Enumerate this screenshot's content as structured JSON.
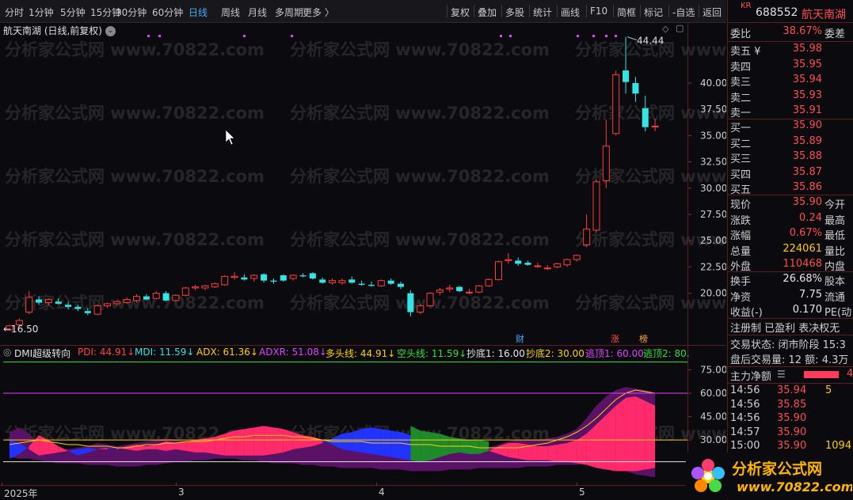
{
  "toolbar": {
    "periods": [
      "分时",
      "1分钟",
      "5分钟",
      "15分钟",
      "30分钟",
      "60分钟",
      "日线",
      "周线",
      "月线",
      "多周期",
      "更多 〉"
    ],
    "active_period": "日线",
    "tools": [
      "复权",
      "叠加",
      "多股",
      "统计",
      "画线",
      "F10",
      "简框",
      "标记",
      "-自选",
      "返回"
    ]
  },
  "stock": {
    "badge": "KR",
    "code": "688552",
    "name": "航天南湖"
  },
  "chart": {
    "title": "航天南湖 (日线,前复权)",
    "price_ticks": [
      "40.00",
      "37.50",
      "35.00",
      "32.50",
      "30.00",
      "27.50",
      "25.00",
      "22.50",
      "20.00"
    ],
    "high_label": "44.44",
    "low_label": "16.50",
    "markers": {
      "cai": "财",
      "zhang": "涨",
      "bang": "榜"
    },
    "dates": [
      "2025年",
      "3",
      "4",
      "5"
    ],
    "indicator_ticks": [
      "75.00",
      "60.00",
      "45.00",
      "30.00"
    ],
    "watermark": "分析家公式网 www.70822.com"
  },
  "indicator": {
    "name": "DMI超级转向",
    "items": [
      {
        "label": "PDI: 44.91",
        "color": "#ff4040"
      },
      {
        "label": "MDI: 11.59",
        "color": "#33e0e0"
      },
      {
        "label": "ADX: 61.36",
        "color": "#ffd000"
      },
      {
        "label": "ADXR: 51.08",
        "color": "#e040ff"
      },
      {
        "label": "多头线: 44.91",
        "color": "#ffd000"
      },
      {
        "label": "空头线: 11.59",
        "color": "#33e033"
      },
      {
        "label": "抄底1: 16.00",
        "color": "#e6e6e6"
      },
      {
        "label": "抄底2: 30.00",
        "color": "#ffd000"
      },
      {
        "label": "逃顶1: 60.00",
        "color": "#e040ff"
      },
      {
        "label": "逃顶2: 80.",
        "color": "#33e033"
      }
    ]
  },
  "chart_data": {
    "type": "candlestick",
    "note_series": "daily OHLC read from chart",
    "candles": [
      [
        16.5,
        17.0,
        16.4,
        16.9
      ],
      [
        17.0,
        17.6,
        16.8,
        17.4
      ],
      [
        18.2,
        20.2,
        18.0,
        19.6
      ],
      [
        19.4,
        19.7,
        18.9,
        19.1
      ],
      [
        19.1,
        19.5,
        18.8,
        19.4
      ],
      [
        19.2,
        19.5,
        18.9,
        19.0
      ],
      [
        18.9,
        19.2,
        18.5,
        18.7
      ],
      [
        18.7,
        18.9,
        18.3,
        18.5
      ],
      [
        18.3,
        18.6,
        17.9,
        18.1
      ],
      [
        18.0,
        18.9,
        17.9,
        18.8
      ],
      [
        18.8,
        19.1,
        18.6,
        19.0
      ],
      [
        19.0,
        19.3,
        18.8,
        19.2
      ],
      [
        19.1,
        19.6,
        19.0,
        19.4
      ],
      [
        19.3,
        19.9,
        19.1,
        19.7
      ],
      [
        19.7,
        19.9,
        19.3,
        19.4
      ],
      [
        19.5,
        20.2,
        19.4,
        20.0
      ],
      [
        20.0,
        20.2,
        19.2,
        19.3
      ],
      [
        19.3,
        19.9,
        19.2,
        19.8
      ],
      [
        19.8,
        20.6,
        19.7,
        20.5
      ],
      [
        20.5,
        20.8,
        20.3,
        20.6
      ],
      [
        20.5,
        20.8,
        20.3,
        20.7
      ],
      [
        20.6,
        21.0,
        20.5,
        20.9
      ],
      [
        20.8,
        21.7,
        20.7,
        21.6
      ],
      [
        21.5,
        22.0,
        21.3,
        21.6
      ],
      [
        21.5,
        21.8,
        21.2,
        21.3
      ],
      [
        21.4,
        21.8,
        21.1,
        21.7
      ],
      [
        21.8,
        21.9,
        21.0,
        21.2
      ],
      [
        21.2,
        21.4,
        20.9,
        21.1
      ],
      [
        21.7,
        21.8,
        21.1,
        21.2
      ],
      [
        21.4,
        21.8,
        21.2,
        21.7
      ],
      [
        21.7,
        21.9,
        21.5,
        21.6
      ],
      [
        21.9,
        22.0,
        21.3,
        21.4
      ],
      [
        21.3,
        21.5,
        20.9,
        21.0
      ],
      [
        21.0,
        21.4,
        20.8,
        21.2
      ],
      [
        21.0,
        21.4,
        20.8,
        21.2
      ],
      [
        21.3,
        21.6,
        20.9,
        21.0
      ],
      [
        20.9,
        21.2,
        20.7,
        20.8
      ],
      [
        20.8,
        21.1,
        20.6,
        20.7
      ],
      [
        20.7,
        21.3,
        20.6,
        21.2
      ],
      [
        21.2,
        21.4,
        20.8,
        20.9
      ],
      [
        20.9,
        21.1,
        20.4,
        20.6
      ],
      [
        20.0,
        20.3,
        17.8,
        18.2
      ],
      [
        18.2,
        19.0,
        18.0,
        18.8
      ],
      [
        18.8,
        20.1,
        18.7,
        20.0
      ],
      [
        20.1,
        20.5,
        19.8,
        20.3
      ],
      [
        20.4,
        20.8,
        20.1,
        20.5
      ],
      [
        20.6,
        20.7,
        20.1,
        20.2
      ],
      [
        20.1,
        20.4,
        19.9,
        20.1
      ],
      [
        20.1,
        20.8,
        20.0,
        20.7
      ],
      [
        20.7,
        21.4,
        20.6,
        21.3
      ],
      [
        21.3,
        23.1,
        21.2,
        23.0
      ],
      [
        23.1,
        23.8,
        22.8,
        23.2
      ],
      [
        23.1,
        23.4,
        22.6,
        22.8
      ],
      [
        22.9,
        23.1,
        22.6,
        22.7
      ],
      [
        22.6,
        22.9,
        22.4,
        22.6
      ],
      [
        22.4,
        22.7,
        22.2,
        22.4
      ],
      [
        22.5,
        22.9,
        22.4,
        22.8
      ],
      [
        22.7,
        23.3,
        22.5,
        23.2
      ],
      [
        23.2,
        23.7,
        23.0,
        23.6
      ],
      [
        24.6,
        27.5,
        24.4,
        26.1
      ],
      [
        26.0,
        30.8,
        25.8,
        30.6
      ],
      [
        30.7,
        36.5,
        30.0,
        34.0
      ],
      [
        35.2,
        41.2,
        35.0,
        40.8
      ],
      [
        41.2,
        44.4,
        39.0,
        40.1
      ],
      [
        40.0,
        40.6,
        38.2,
        39.0
      ],
      [
        37.6,
        38.8,
        35.4,
        35.8
      ],
      [
        35.9,
        36.6,
        35.4,
        35.9
      ]
    ]
  },
  "quote": {
    "ratio_label": "委比",
    "ratio_value": "38.67%",
    "ratio_right": "委差",
    "asks": [
      {
        "label": "卖五 ¥",
        "price": "35.98"
      },
      {
        "label": "卖四",
        "price": "35.95"
      },
      {
        "label": "卖三",
        "price": "35.94"
      },
      {
        "label": "卖二",
        "price": "35.93"
      },
      {
        "label": "卖一",
        "price": "35.91"
      }
    ],
    "bids": [
      {
        "label": "买一",
        "price": "35.90"
      },
      {
        "label": "买二",
        "price": "35.89"
      },
      {
        "label": "买三",
        "price": "35.88"
      },
      {
        "label": "买四",
        "price": "35.87"
      },
      {
        "label": "买五",
        "price": "35.86"
      }
    ],
    "stats": [
      {
        "label": "现价",
        "value": "35.90",
        "right": "今开"
      },
      {
        "label": "涨跌",
        "value": "0.24",
        "right": "最高"
      },
      {
        "label": "涨幅",
        "value": "0.67%",
        "right": "最低"
      },
      {
        "label": "总量",
        "value": "224061",
        "right": "量比"
      },
      {
        "label": "外盘",
        "value": "110468",
        "right": "内盘"
      }
    ],
    "stats2": [
      {
        "label": "换手",
        "value": "26.68%",
        "right": "股本"
      },
      {
        "label": "净资",
        "value": "7.75",
        "right": "流通"
      },
      {
        "label": "收益(-)",
        "value": "0.170",
        "right": "PE(动"
      }
    ],
    "reg": "注册制 已盈利 表决权无",
    "trade_status": "交易状态: 闭市阶段 15:3",
    "after_hours": "盘后交易量: 12  额: 4.3万",
    "net_flow_label": "主力净额",
    "net_flow_value": "4",
    "ticks": [
      {
        "time": "14:56",
        "price": "35.94",
        "vol": "5"
      },
      {
        "time": "14:56",
        "price": "35.85",
        "vol": ""
      },
      {
        "time": "14:56",
        "price": "35.90",
        "vol": ""
      },
      {
        "time": "14:57",
        "price": "35.90",
        "vol": ""
      },
      {
        "time": "15:00",
        "price": "35.90",
        "vol": "1094"
      }
    ]
  },
  "logo": {
    "text": "分析家公式网",
    "url": "www.70822.com"
  }
}
